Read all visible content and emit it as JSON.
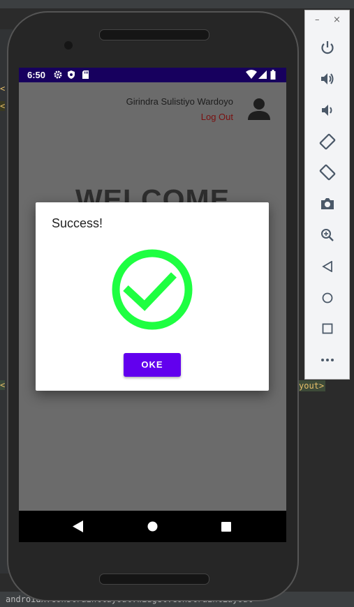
{
  "colors": {
    "status_bar": "#17005e",
    "accent_button": "#6200ee",
    "success_green": "#1eff41",
    "logout_text": "#7a1010",
    "scrim": "#6b6b6b"
  },
  "status_bar": {
    "time": "6:50",
    "icons": [
      "settings-icon",
      "shield-icon",
      "sd-card-icon",
      "wifi-icon",
      "signal-icon",
      "battery-icon"
    ]
  },
  "header": {
    "username": "Girindra Sulistiyo Wardoyo",
    "logout_label": "Log Out",
    "avatar_icon": "person-icon"
  },
  "main": {
    "welcome_text": "WELCOME"
  },
  "dialog": {
    "title": "Success!",
    "icon": "check-circle-icon",
    "button_label": "OKE"
  },
  "nav_bar": {
    "icons": [
      "back-icon",
      "home-icon",
      "recents-icon"
    ]
  },
  "emulator_toolbar": {
    "window_controls": [
      "minimize-icon",
      "close-icon"
    ],
    "minimize_glyph": "–",
    "close_glyph": "×",
    "buttons": [
      "power-icon",
      "volume-up-icon",
      "volume-down-icon",
      "rotate-left-icon",
      "rotate-right-icon",
      "camera-icon",
      "zoom-icon",
      "back-icon",
      "home-icon",
      "overview-icon",
      "more-icon"
    ]
  },
  "ide": {
    "status_path": "androidx.constraintlayout.widget.ConstraintLayout",
    "editor_tag": "yout>"
  }
}
